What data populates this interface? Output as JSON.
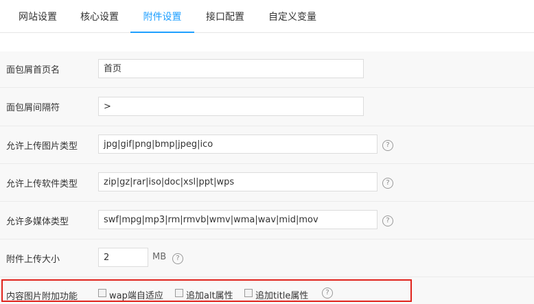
{
  "tabs": [
    {
      "label": "网站设置"
    },
    {
      "label": "核心设置"
    },
    {
      "label": "附件设置"
    },
    {
      "label": "接口配置"
    },
    {
      "label": "自定义变量"
    }
  ],
  "active_tab": "附件设置",
  "fields": {
    "breadcrumb_home": {
      "label": "面包屑首页名",
      "value": "首页"
    },
    "breadcrumb_separator": {
      "label": "面包屑间隔符",
      "value": ">"
    },
    "image_types": {
      "label": "允许上传图片类型",
      "value": "jpg|gif|png|bmp|jpeg|ico"
    },
    "software_types": {
      "label": "允许上传软件类型",
      "value": "zip|gz|rar|iso|doc|xsl|ppt|wps"
    },
    "media_types": {
      "label": "允许多媒体类型",
      "value": "swf|mpg|mp3|rm|rmvb|wmv|wma|wav|mid|mov"
    },
    "upload_size": {
      "label": "附件上传大小",
      "value": "2",
      "unit": "MB"
    }
  },
  "image_features": {
    "label": "内容图片附加功能",
    "options": [
      {
        "label": "wap端自适应",
        "checked": false
      },
      {
        "label": "追加alt属性",
        "checked": false
      },
      {
        "label": "追加title属性",
        "checked": false
      }
    ]
  },
  "help_icon_glyph": "?",
  "colors": {
    "accent": "#1e9fff",
    "highlight_box": "#e0231c",
    "row_bg": "#f8f8f8"
  }
}
